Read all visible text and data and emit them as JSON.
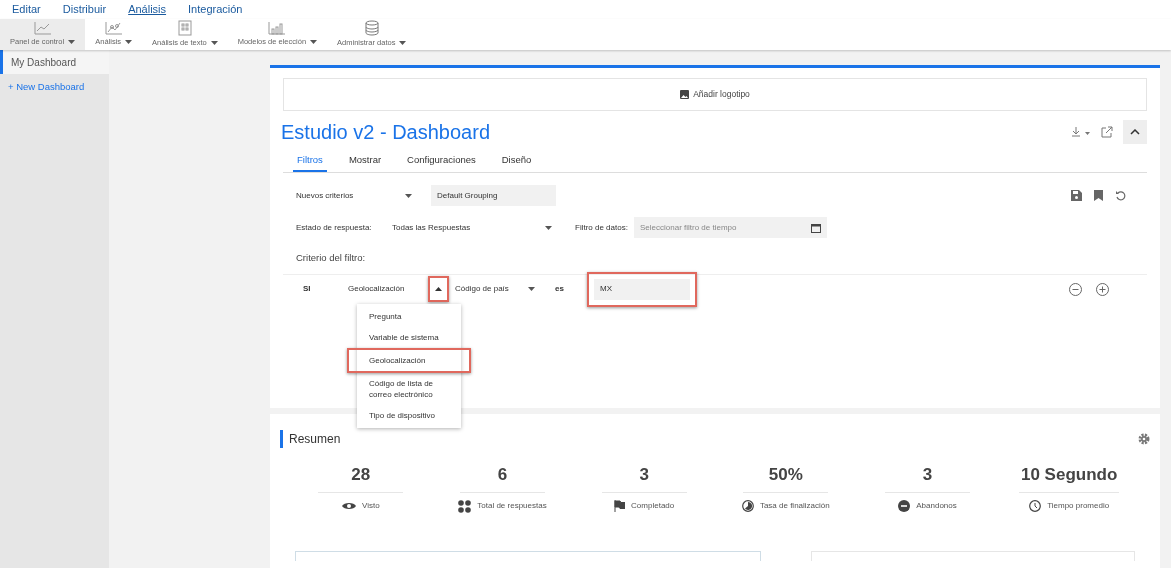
{
  "menu": [
    {
      "label": "Editar",
      "selected": false
    },
    {
      "label": "Distribuir",
      "selected": false
    },
    {
      "label": "Análisis",
      "selected": true
    },
    {
      "label": "Integración",
      "selected": false
    }
  ],
  "toolbar": [
    {
      "label": "Panel de control",
      "kind": "line",
      "selected": true
    },
    {
      "label": "Análisis",
      "kind": "scatter",
      "selected": false
    },
    {
      "label": "Análisis de texto",
      "kind": "text",
      "selected": false
    },
    {
      "label": "Modelos de elección",
      "kind": "bars",
      "selected": false
    },
    {
      "label": "Administrar datos",
      "kind": "database",
      "selected": false
    }
  ],
  "sidebar": {
    "items": [
      {
        "label": "My Dashboard",
        "selected": true
      }
    ],
    "new_link": "+ New Dashboard"
  },
  "logo_button": "Añadir logotipo",
  "title": "Estudio v2 - Dashboard",
  "tabs": [
    {
      "label": "Filtros",
      "selected": true
    },
    {
      "label": "Mostrar",
      "selected": false
    },
    {
      "label": "Configuraciones",
      "selected": false
    },
    {
      "label": "Diseño",
      "selected": false
    }
  ],
  "filters": {
    "criteria_select": "Nuevos criterios",
    "grouping": "Default Grouping",
    "status_label": "Estado de respuesta:",
    "status_value": "Todas las Respuestas",
    "date_label": "Filtro de datos:",
    "date_placeholder": "Seleccionar filtro de tiempo",
    "criteria_heading": "Criterio del filtro:",
    "row": {
      "condition": "SI",
      "field": "Geolocalización",
      "field_caret_highlighted": true,
      "subfield": "Código de país",
      "operator": "es",
      "value": "MX",
      "value_highlighted": true
    },
    "menu": {
      "expanded": true,
      "items": [
        {
          "label": "Pregunta",
          "selected": false
        },
        {
          "label": "Variable de sistema",
          "selected": false
        },
        {
          "label": "Geolocalización",
          "selected": true
        },
        {
          "label": "Código de lista de correo electrónico",
          "selected": false
        },
        {
          "label": "Tipo de dispositivo",
          "selected": false
        }
      ]
    }
  },
  "summary": {
    "title": "Resumen",
    "stats": [
      {
        "value": "28",
        "label": "Visto",
        "kind": "eye"
      },
      {
        "value": "6",
        "label": "Total de respuestas",
        "kind": "dots"
      },
      {
        "value": "3",
        "label": "Completado",
        "kind": "flag"
      },
      {
        "value": "50%",
        "label": "Tasa de finalización",
        "kind": "progress"
      },
      {
        "value": "3",
        "label": "Abandonos",
        "kind": "minus"
      },
      {
        "value": "10 Segundo",
        "label": "Tiempo promedio",
        "kind": "clock"
      }
    ]
  }
}
